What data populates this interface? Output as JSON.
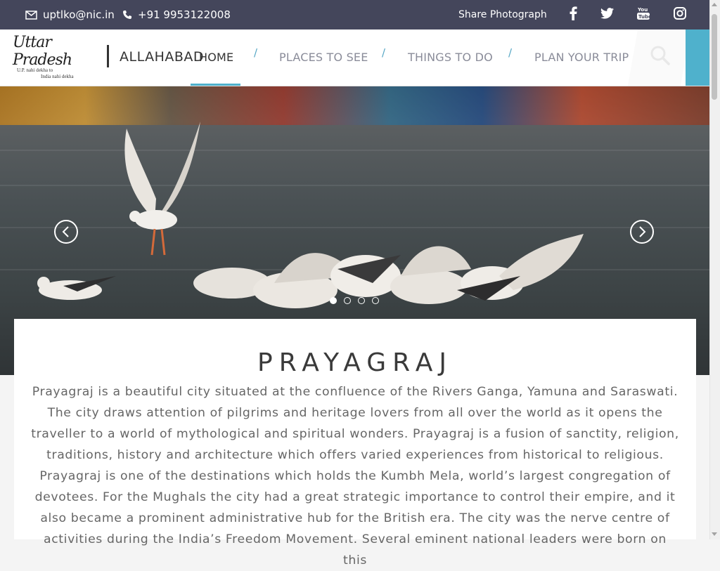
{
  "topbar": {
    "email": "uptlko@nic.in",
    "phone": "+91 9953122008",
    "share_label": "Share Photograph",
    "social": [
      "facebook-icon",
      "twitter-icon",
      "youtube-icon",
      "instagram-icon"
    ]
  },
  "header": {
    "logo_script": "Uttar Pradesh",
    "logo_tagline_1": "U.P. nahi dekha to",
    "logo_tagline_2": "India nahi dekha",
    "city": "ALLAHABAD",
    "nav": [
      {
        "label": "HOME",
        "active": true
      },
      {
        "label": "PLACES TO SEE"
      },
      {
        "label": "THINGS TO DO"
      },
      {
        "label": "PLAN YOUR TRIP"
      }
    ],
    "nav_separator": "/"
  },
  "hero": {
    "slide_count": 4,
    "active_slide": 1
  },
  "content": {
    "title": "PRAYAGRAJ",
    "body": "Prayagraj is a beautiful city situated at the confluence of the Rivers Ganga, Yamuna and Saraswati. The city draws attention of pilgrims and heritage lovers from all over the world as it opens the traveller to a world of mythological and spiritual wonders. Prayagraj is a fusion of sanctity, religion, traditions, history and architecture which offers varied experiences from historical to religious. Prayagraj is one of the destinations which holds the Kumbh Mela, world’s largest congregation of devotees. For the Mughals the city had a great strategic importance to control their empire, and it also became a prominent administrative hub for the British era. The city was the nerve centre of activities during the India’s Freedom Movement. Several eminent national leaders were born on this"
  },
  "colors": {
    "topbar": "#44465b",
    "accent": "#4fb1cc",
    "nav_text": "#8a8c99"
  }
}
